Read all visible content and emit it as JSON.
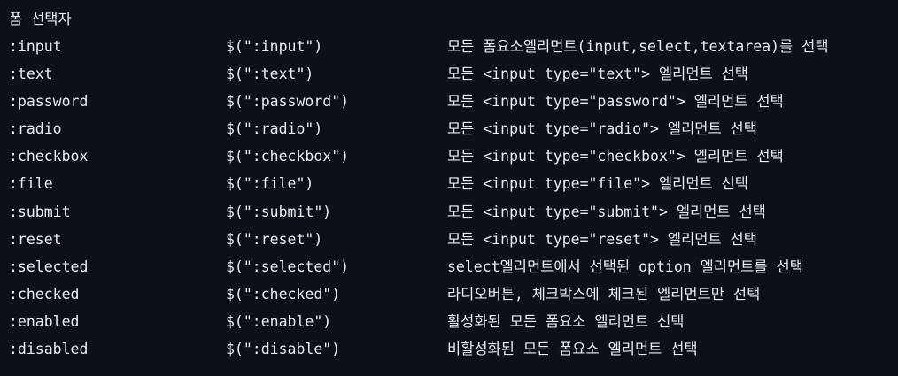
{
  "title": "폼 선택자",
  "rows": [
    {
      "selector": ":input",
      "usage": "$(\":input\")",
      "desc": "모든 폼요소엘리먼트(input,select,textarea)를 선택"
    },
    {
      "selector": ":text",
      "usage": "$(\":text\")",
      "desc": "모든 <input type=\"text\"> 엘리먼트 선택"
    },
    {
      "selector": ":password",
      "usage": "$(\":password\")",
      "desc": "모든 <input type=\"password\"> 엘리먼트 선택"
    },
    {
      "selector": ":radio",
      "usage": "$(\":radio\")",
      "desc": "모든 <input type=\"radio\"> 엘리먼트 선택"
    },
    {
      "selector": ":checkbox",
      "usage": "$(\":checkbox\")",
      "desc": "모든 <input type=\"checkbox\"> 엘리먼트 선택"
    },
    {
      "selector": ":file",
      "usage": "$(\":file\")",
      "desc": "모든 <input type=\"file\"> 엘리먼트 선택"
    },
    {
      "selector": ":submit",
      "usage": "$(\":submit\")",
      "desc": "모든 <input type=\"submit\"> 엘리먼트 선택"
    },
    {
      "selector": ":reset",
      "usage": "$(\":reset\")",
      "desc": "모든 <input type=\"reset\"> 엘리먼트 선택"
    },
    {
      "selector": ":selected",
      "usage": "$(\":selected\")",
      "desc": "select엘리먼트에서 선택된 option 엘리먼트를 선택"
    },
    {
      "selector": ":checked",
      "usage": "$(\":checked\")",
      "desc": "라디오버튼, 체크박스에 체크된 엘리먼트만 선택"
    },
    {
      "selector": ":enabled",
      "usage": "$(\":enable\")",
      "desc": "활성화된 모든 폼요소 엘리먼트 선택"
    },
    {
      "selector": ":disabled",
      "usage": "$(\":disable\")",
      "desc": "비활성화된 모든 폼요소 엘리먼트 선택"
    }
  ]
}
